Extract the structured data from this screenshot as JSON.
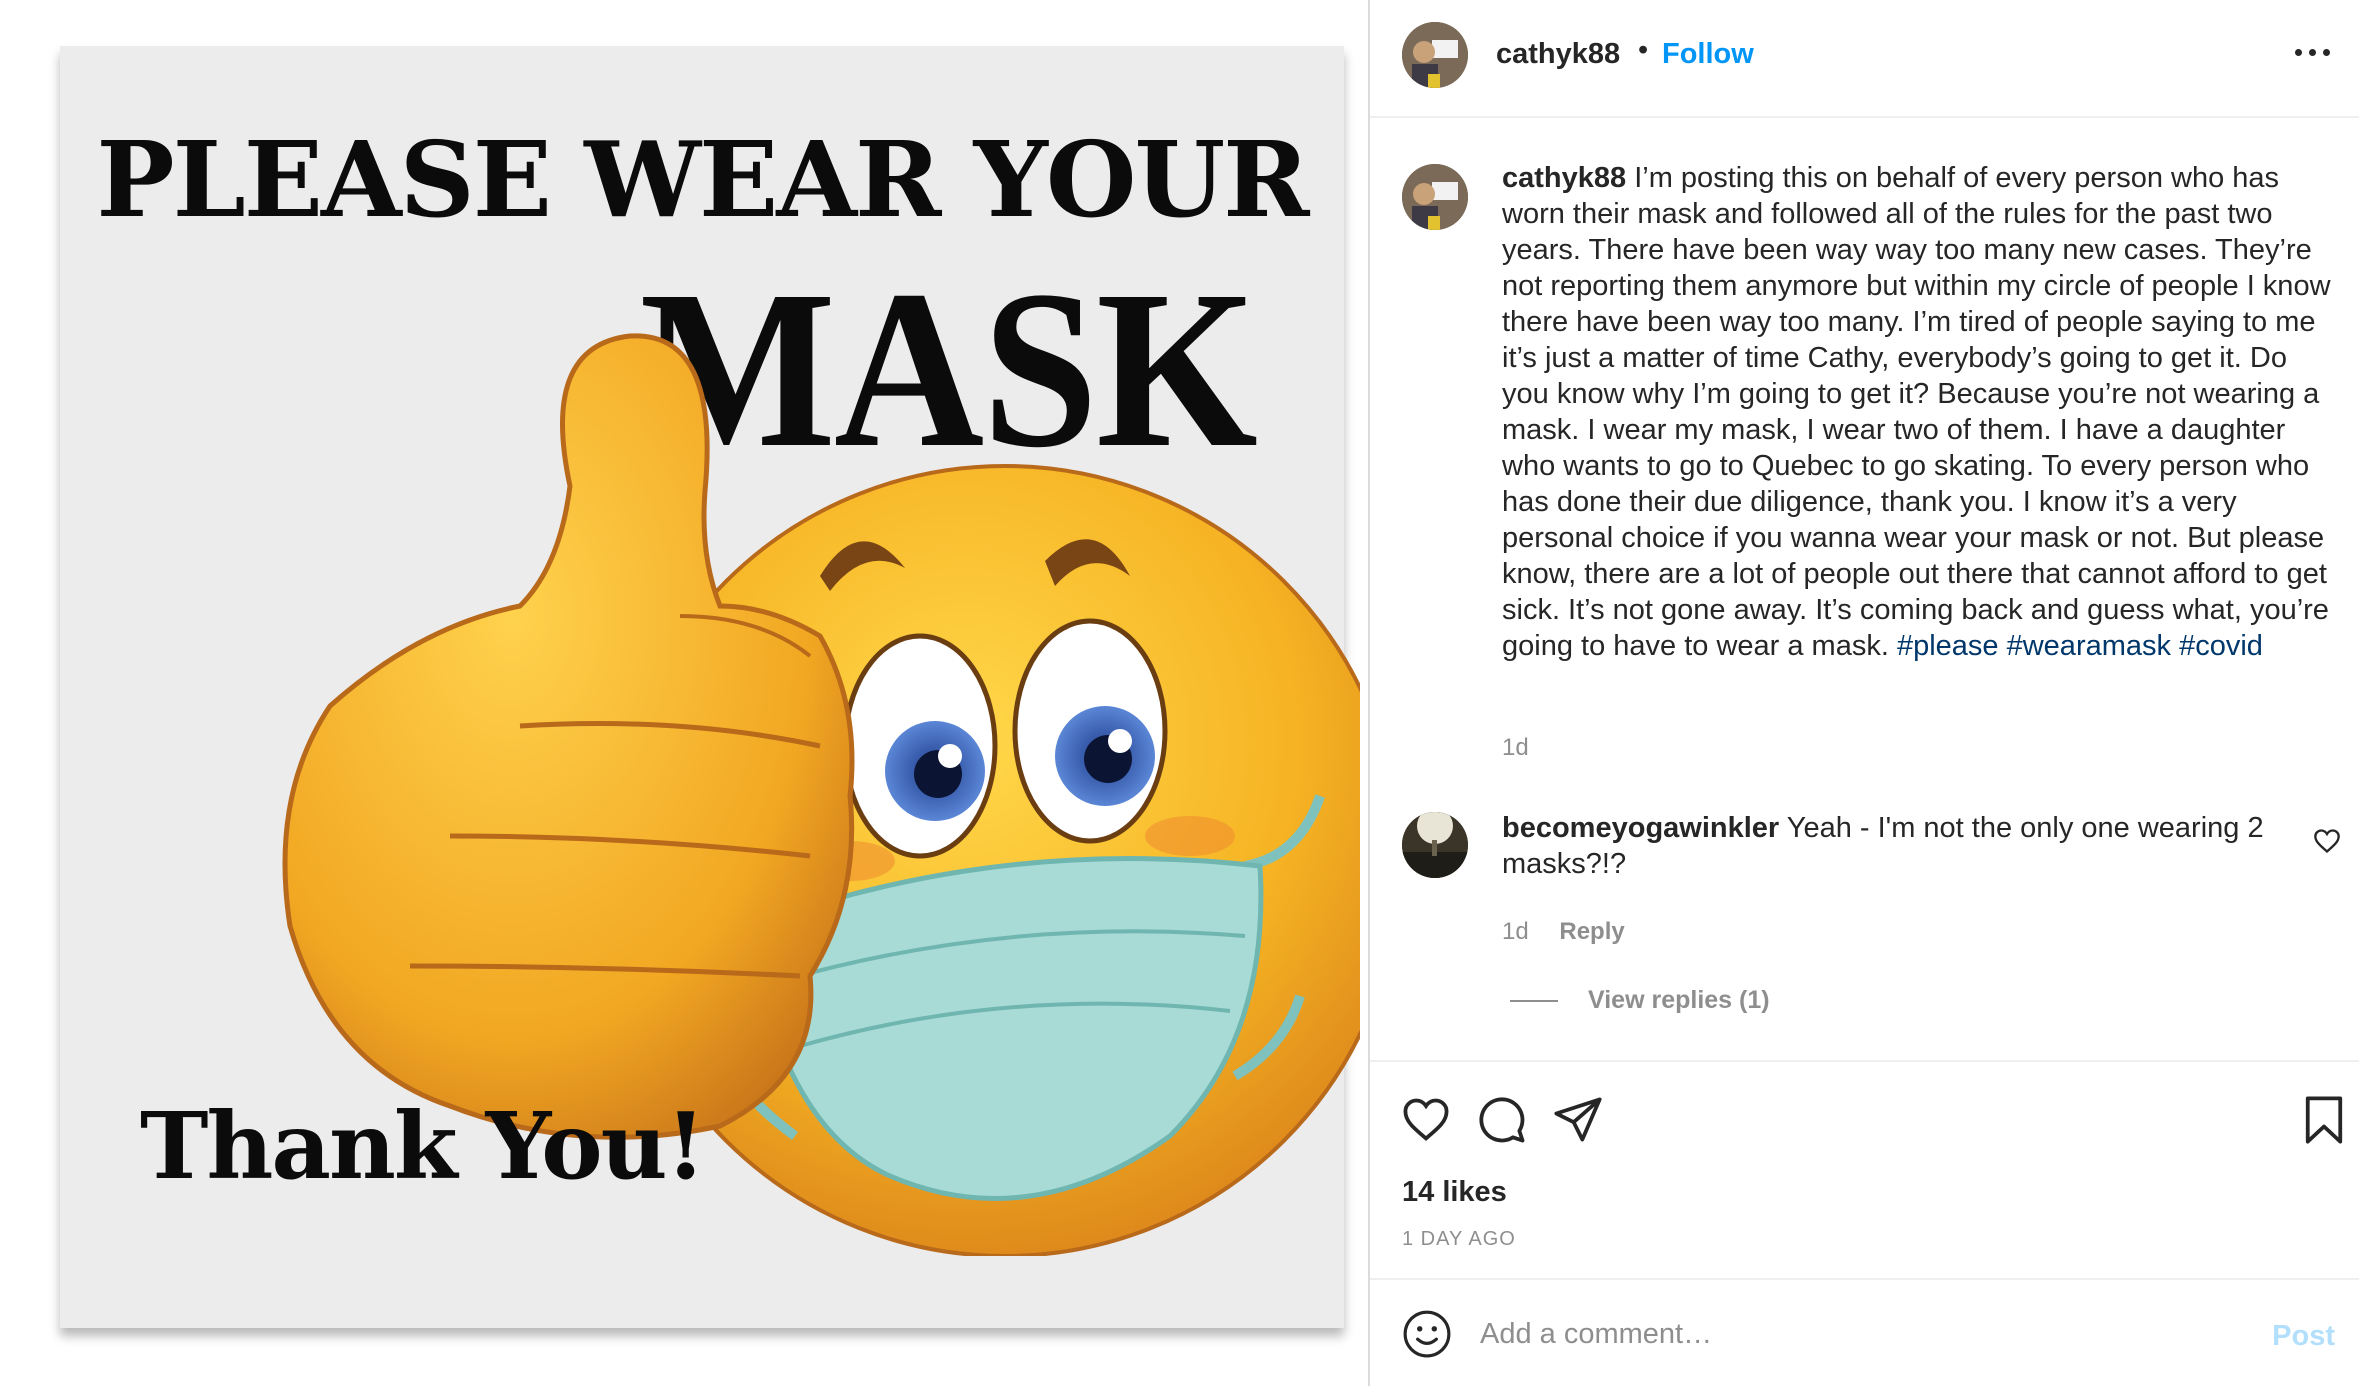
{
  "post_image": {
    "headline": "PLEASE WEAR YOUR",
    "headline_big": "MASK",
    "footer": "Thank You!"
  },
  "header": {
    "username": "cathyk88",
    "separator": "•",
    "follow_label": "Follow",
    "more_icon": "more-options-icon"
  },
  "caption": {
    "username": "cathyk88",
    "text": "I’m posting this on behalf of every person who has worn their mask and followed all of the rules for the past two years. There have been way way too many new cases. They’re not reporting them anymore but within my circle of people I know there have been way too many. I’m tired of people saying to me it’s just a matter of time Cathy, everybody’s going to get it. Do you know why I’m going to get it? Because you’re not wearing a mask. I wear my mask, I wear two of them. I have a daughter who wants to go to Quebec to go skating. To every person who has done their due diligence, thank you. I know it’s a very personal choice if you wanna wear your mask or not. But please know, there are a lot of people out there that cannot afford to get sick. It’s not gone away. It’s coming back and guess what, you’re going to have to wear a mask.",
    "hashtags": [
      "#please",
      "#wearamask",
      "#covid"
    ],
    "time": "1d"
  },
  "comments": [
    {
      "username": "becomeyogawinkler",
      "text": "Yeah - I'm not the only one wearing 2 masks?!?",
      "time": "1d",
      "reply_label": "Reply",
      "view_replies": "View replies (1)"
    }
  ],
  "engagement": {
    "likes": "14 likes",
    "posted": "1 DAY AGO"
  },
  "comment_box": {
    "placeholder": "Add a comment…",
    "post_label": "Post"
  },
  "colors": {
    "accent": "#0095f6",
    "hashtag": "#00376b",
    "muted": "#8e8e8e",
    "post_disabled": "#b2dffc",
    "mask": "#a8dad6",
    "emoji_yellow": "#f6b323"
  },
  "icons": [
    "heart-icon",
    "comment-icon",
    "share-icon",
    "bookmark-icon",
    "emoji-icon",
    "like-comment-icon"
  ]
}
